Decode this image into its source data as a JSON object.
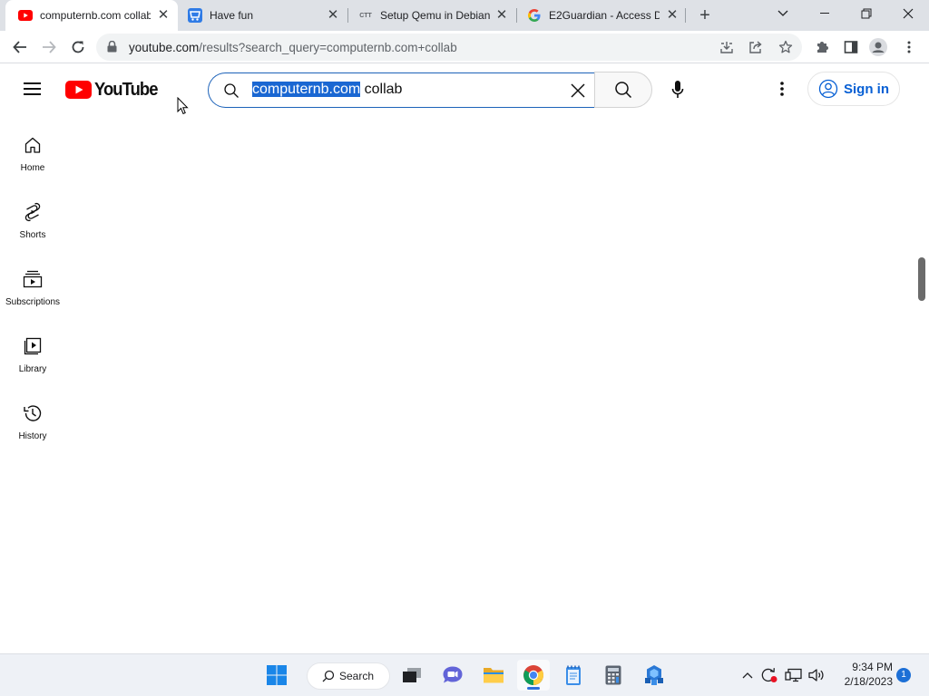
{
  "browser": {
    "tabs": [
      {
        "title": "computernb.com collab",
        "favicon": "youtube-favicon",
        "active": true
      },
      {
        "title": "Have fun",
        "favicon": "shop-favicon",
        "active": false
      },
      {
        "title": "Setup Qemu in Debian",
        "favicon": "ctt-favicon",
        "active": false
      },
      {
        "title": "E2Guardian - Access D",
        "favicon": "google-favicon",
        "active": false
      }
    ],
    "address": {
      "domain": "youtube.com",
      "path": "/results?search_query=computernb.com+collab"
    }
  },
  "youtube": {
    "logo_text": "YouTube",
    "search": {
      "selected_text": "computernb.com",
      "rest_text": " collab"
    },
    "signin_label": "Sign in",
    "guide": [
      {
        "label": "Home",
        "icon": "home-icon"
      },
      {
        "label": "Shorts",
        "icon": "shorts-icon"
      },
      {
        "label": "Subscriptions",
        "icon": "subscriptions-icon"
      },
      {
        "label": "Library",
        "icon": "library-icon"
      },
      {
        "label": "History",
        "icon": "history-icon"
      }
    ]
  },
  "taskbar": {
    "search_label": "Search",
    "time": "9:34 PM",
    "date": "2/18/2023",
    "notification_count": "1"
  },
  "colors": {
    "youtube_red": "#ff0000",
    "link_blue": "#065fd4",
    "selection_blue": "#1a67d2",
    "focus_border": "#1c62b9"
  }
}
